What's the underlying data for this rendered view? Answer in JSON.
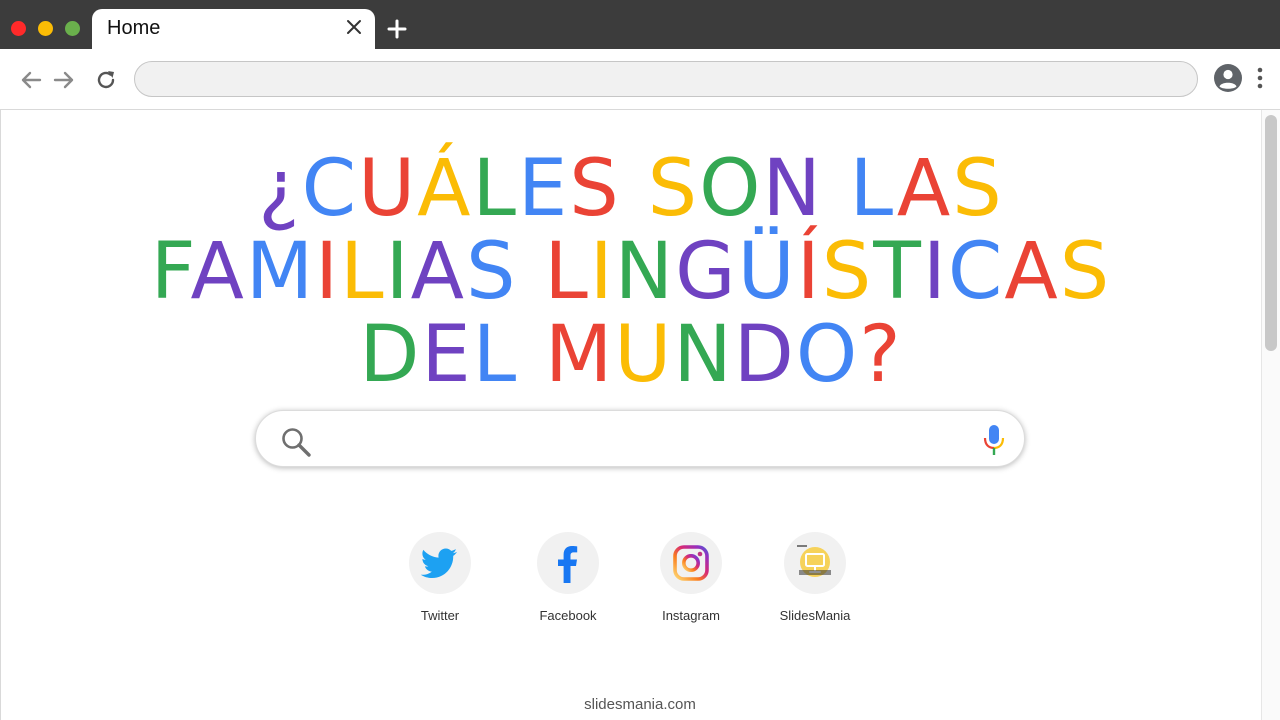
{
  "window": {
    "traffic_lights": [
      {
        "name": "close",
        "color": "#ff2a2a"
      },
      {
        "name": "minimize",
        "color": "#fbbc05"
      },
      {
        "name": "zoom",
        "color": "#6ab04c"
      }
    ]
  },
  "tab": {
    "title": "Home"
  },
  "address_bar": {
    "value": ""
  },
  "headline": {
    "lines": [
      [
        {
          "text": "¿",
          "color": "#6f42c1"
        },
        {
          "text": "C",
          "color": "#4285f4"
        },
        {
          "text": "U",
          "color": "#ea4335"
        },
        {
          "text": "Á",
          "color": "#fbbc05"
        },
        {
          "text": "L",
          "color": "#34a853"
        },
        {
          "text": "E",
          "color": "#4285f4"
        },
        {
          "text": "S",
          "color": "#ea4335"
        },
        {
          "text": " ",
          "color": "#000000"
        },
        {
          "text": "S",
          "color": "#fbbc05"
        },
        {
          "text": "O",
          "color": "#34a853"
        },
        {
          "text": "N",
          "color": "#6f42c1"
        },
        {
          "text": " ",
          "color": "#000000"
        },
        {
          "text": "L",
          "color": "#4285f4"
        },
        {
          "text": "A",
          "color": "#ea4335"
        },
        {
          "text": "S",
          "color": "#fbbc05"
        }
      ],
      [
        {
          "text": "F",
          "color": "#34a853"
        },
        {
          "text": "A",
          "color": "#6f42c1"
        },
        {
          "text": "M",
          "color": "#4285f4"
        },
        {
          "text": "I",
          "color": "#ea4335"
        },
        {
          "text": "L",
          "color": "#fbbc05"
        },
        {
          "text": "I",
          "color": "#34a853"
        },
        {
          "text": "A",
          "color": "#6f42c1"
        },
        {
          "text": "S",
          "color": "#4285f4"
        },
        {
          "text": " ",
          "color": "#000000"
        },
        {
          "text": "L",
          "color": "#ea4335"
        },
        {
          "text": "I",
          "color": "#fbbc05"
        },
        {
          "text": "N",
          "color": "#34a853"
        },
        {
          "text": "G",
          "color": "#6f42c1"
        },
        {
          "text": "Ü",
          "color": "#4285f4"
        },
        {
          "text": "Í",
          "color": "#ea4335"
        },
        {
          "text": "S",
          "color": "#fbbc05"
        },
        {
          "text": "T",
          "color": "#34a853"
        },
        {
          "text": "I",
          "color": "#6f42c1"
        },
        {
          "text": "C",
          "color": "#4285f4"
        },
        {
          "text": "A",
          "color": "#ea4335"
        },
        {
          "text": "S",
          "color": "#fbbc05"
        }
      ],
      [
        {
          "text": "D",
          "color": "#34a853"
        },
        {
          "text": "E",
          "color": "#6f42c1"
        },
        {
          "text": "L",
          "color": "#4285f4"
        },
        {
          "text": " ",
          "color": "#000000"
        },
        {
          "text": "M",
          "color": "#ea4335"
        },
        {
          "text": "U",
          "color": "#fbbc05"
        },
        {
          "text": "N",
          "color": "#34a853"
        },
        {
          "text": "D",
          "color": "#6f42c1"
        },
        {
          "text": "O",
          "color": "#4285f4"
        },
        {
          "text": "?",
          "color": "#ea4335"
        }
      ]
    ]
  },
  "search": {
    "value": "",
    "placeholder": ""
  },
  "shortcuts": [
    {
      "label": "Twitter",
      "icon": "twitter-icon"
    },
    {
      "label": "Facebook",
      "icon": "facebook-icon"
    },
    {
      "label": "Instagram",
      "icon": "instagram-icon"
    },
    {
      "label": "SlidesMania",
      "icon": "slidesmania-logo"
    }
  ],
  "footer": {
    "text": "slidesmania.com"
  },
  "colors": {
    "tabbar": "#3c3c3c",
    "google_blue": "#4285f4",
    "google_red": "#ea4335",
    "google_yellow": "#fbbc05",
    "google_green": "#34a853",
    "purple": "#6f42c1"
  }
}
